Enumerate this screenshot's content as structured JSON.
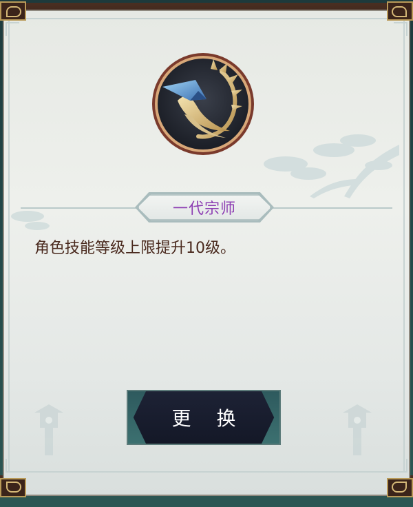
{
  "panel": {
    "icon": "crane-emblem-icon",
    "title": "一代宗师",
    "description": "角色技能等级上限提升10级。",
    "title_color": "#8d3fb3",
    "description_color": "#4a2a1e"
  },
  "actions": {
    "change_label": "更 换"
  },
  "decor": {
    "tree_icon": "pine-tree-decoration-icon",
    "lantern_icon": "stone-lantern-icon"
  }
}
